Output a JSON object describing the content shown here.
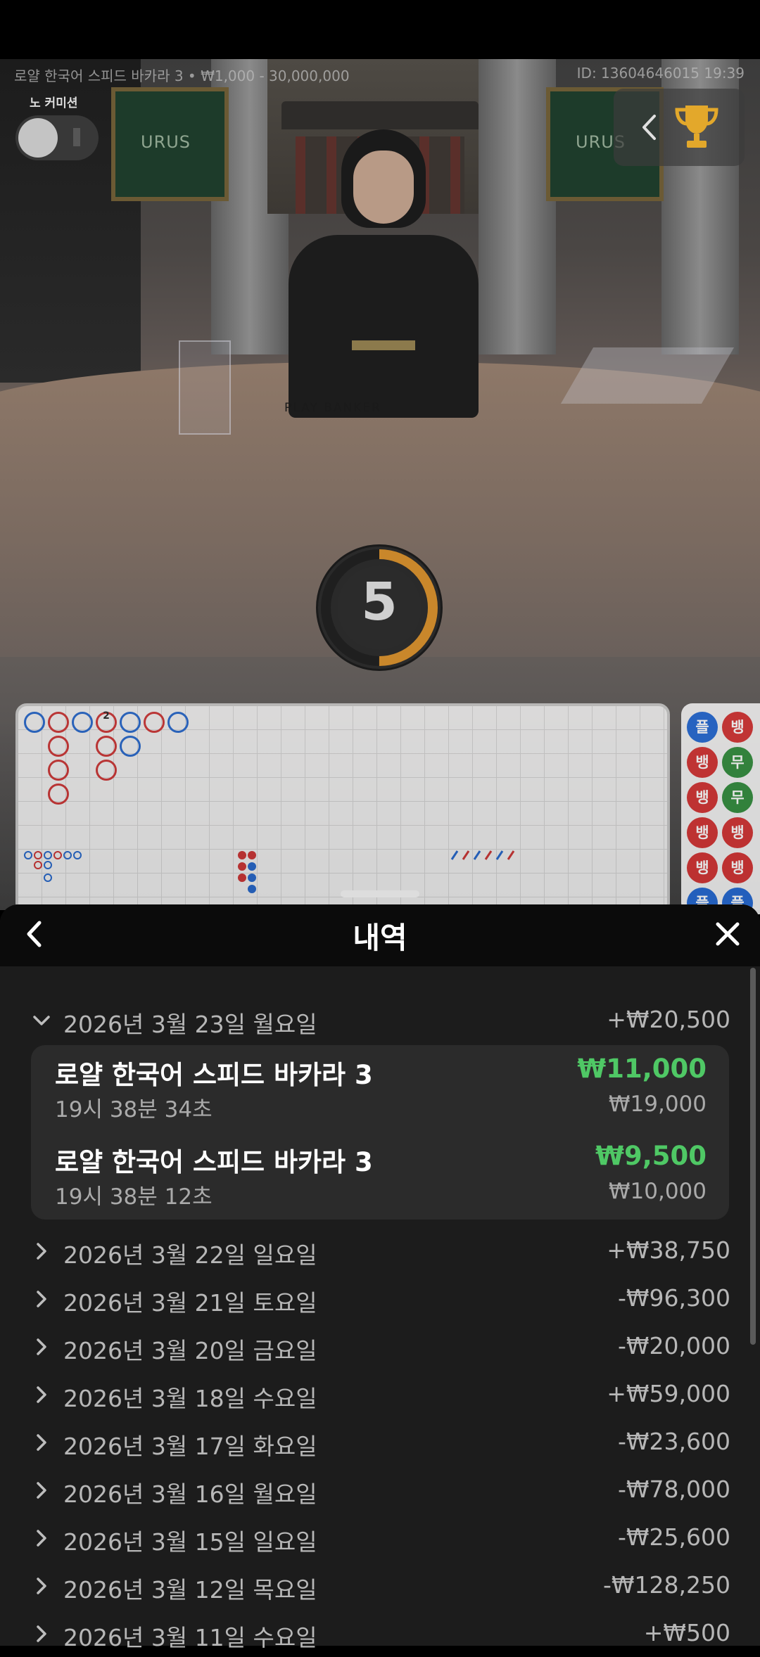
{
  "video": {
    "table_info": "로얄 한국어 스피드 바카라 3 • ₩1,000 - 30,000,000",
    "round_id": "ID: 13604646015 19:39",
    "no_commission_label": "노 커미션",
    "screen_brand": "URUS",
    "table_print": "PLAY  BANKER",
    "countdown": "5",
    "countdown_fraction": 0.5,
    "accent_color": "#c9872b"
  },
  "roadmap": {
    "bead_labels": [
      "플",
      "뱅",
      "뱅",
      "무",
      "뱅",
      "무",
      "뱅",
      "뱅",
      "뱅",
      "뱅",
      "플",
      "플"
    ],
    "bead_colors": [
      "#1f66d3",
      "#d32f2f",
      "#d32f2f",
      "#2e8b3a",
      "#d32f2f",
      "#2e8b3a",
      "#d32f2f",
      "#d32f2f",
      "#d32f2f",
      "#d32f2f",
      "#1f66d3",
      "#1f66d3"
    ],
    "tie_count_label": "2"
  },
  "history": {
    "title": "내역",
    "days": [
      {
        "date": "2026년 3월 23일 월요일",
        "amount": "+₩20,500",
        "expanded": true
      },
      {
        "date": "2026년 3월 22일 일요일",
        "amount": "+₩38,750"
      },
      {
        "date": "2026년 3월 21일 토요일",
        "amount": "-₩96,300"
      },
      {
        "date": "2026년 3월 20일 금요일",
        "amount": "-₩20,000"
      },
      {
        "date": "2026년 3월 18일 수요일",
        "amount": "+₩59,000"
      },
      {
        "date": "2026년 3월 17일 화요일",
        "amount": "-₩23,600"
      },
      {
        "date": "2026년 3월 16일 월요일",
        "amount": "-₩78,000"
      },
      {
        "date": "2026년 3월 15일 일요일",
        "amount": "-₩25,600"
      },
      {
        "date": "2026년 3월 12일 목요일",
        "amount": "-₩128,250"
      },
      {
        "date": "2026년 3월 11일 수요일",
        "amount": "+₩500"
      }
    ],
    "bets": [
      {
        "game": "로얄 한국어 스피드 바카라 3",
        "time": "19시 38분 34초",
        "win": "₩11,000",
        "stake": "₩19,000"
      },
      {
        "game": "로얄 한국어 스피드 바카라 3",
        "time": "19시 38분 12초",
        "win": "₩9,500",
        "stake": "₩10,000"
      }
    ],
    "win_color": "#4fc865"
  }
}
